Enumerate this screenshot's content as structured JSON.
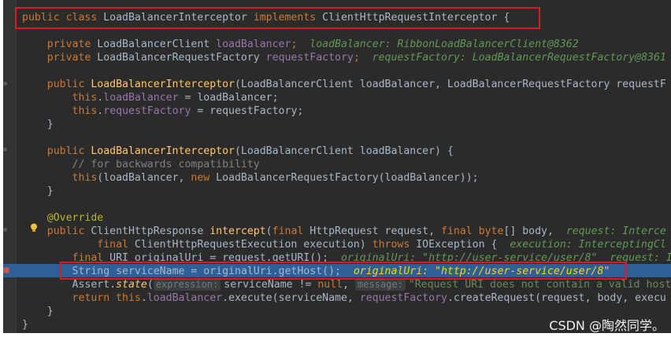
{
  "code": {
    "l1": {
      "kw1": "public class ",
      "cls": "LoadBalancerInterceptor ",
      "kw2": "implements ",
      "iface": "ClientHttpRequestInterceptor {"
    },
    "l2": {
      "kw": "private ",
      "type": "LoadBalancerClient ",
      "field": "loadBalancer",
      "semi": ";",
      "hint": "loadBalancer: RibbonLoadBalancerClient@8362"
    },
    "l3": {
      "kw": "private ",
      "type": "LoadBalancerRequestFactory ",
      "field": "requestFactory",
      "semi": ";",
      "hint": "requestFactory: LoadBalancerRequestFactory@8361"
    },
    "l4": {
      "kw": "public ",
      "fn": "LoadBalancerInterceptor",
      "rest": "(LoadBalancerClient loadBalancer, LoadBalancerRequestFactory requestF"
    },
    "l5": {
      "kw": "this",
      "dot": ".",
      "field": "loadBalancer",
      "rest": " = loadBalancer;"
    },
    "l6": {
      "kw": "this",
      "dot": ".",
      "field": "requestFactory",
      "rest": " = requestFactory;"
    },
    "l7": "}",
    "l8": {
      "kw": "public ",
      "fn": "LoadBalancerInterceptor",
      "rest": "(LoadBalancerClient loadBalancer) {"
    },
    "l9": "// for backwards compatibility",
    "l10": {
      "kw1": "this",
      "mid": "(loadBalancer, ",
      "kw2": "new ",
      "rest": "LoadBalancerRequestFactory(loadBalancer));"
    },
    "l11": "}",
    "l12": "@Override",
    "l13": {
      "kw": "public ",
      "type": "ClientHttpResponse ",
      "fn": "intercept",
      "p1": "(",
      "kw2": "final ",
      "a": "HttpRequest request, ",
      "kw3": "final byte",
      "b": "[] body,",
      "hint": "request: Interce"
    },
    "l14": {
      "kw": "final ",
      "a": "ClientHttpRequestExecution execution) ",
      "kw2": "throws ",
      "b": "IOException {",
      "hint": "execution: InterceptingCl"
    },
    "l15": {
      "kw": "final ",
      "a": "URI originalUri = request.getURI();",
      "hint": "originalUri: \"http://user-service/user/8\"  request: I"
    },
    "l16": {
      "a": "String serviceName = originalUri.getHost();",
      "hint": "originalUri: \"http://user-service/user/8\""
    },
    "l17": {
      "a": "Assert.",
      "fn": "state",
      "p": "(",
      "ph1": "expression:",
      "b": "serviceName != ",
      "kw": "null",
      "c": ", ",
      "ph2": "message:",
      "str": "\"Request URI does not contain a valid host"
    },
    "l18": {
      "kw": "return this",
      "dot": ".",
      "field": "loadBalancer",
      "rest": ".execute(serviceName, ",
      "field2": "requestFactory",
      "rest2": ".createRequest(request, body, execu"
    },
    "l19": "}",
    "l20": "}"
  },
  "watermark": "CSDN @陶然同学。"
}
